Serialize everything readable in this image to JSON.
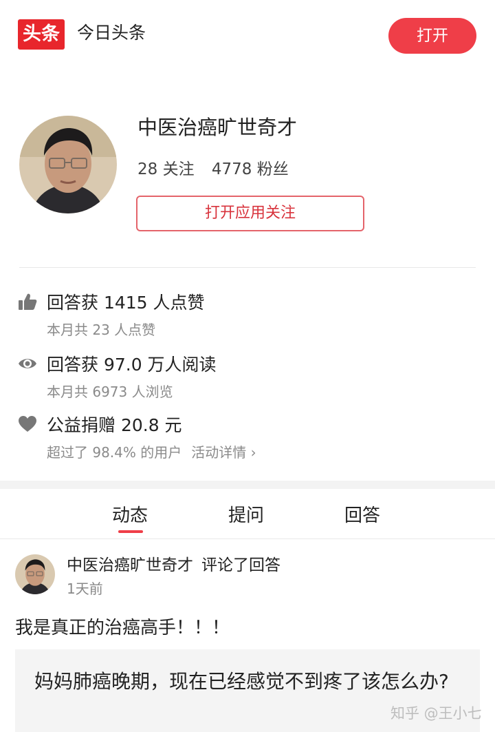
{
  "header": {
    "logo_text": "头条",
    "app_name": "今日头条",
    "open_label": "打开",
    "accent_color": "#ef3e48"
  },
  "profile": {
    "name": "中医治癌旷世奇才",
    "following": "28 关注",
    "followers": "4778 粉丝",
    "follow_button": "打开应用关注"
  },
  "stats": [
    {
      "icon": "thumbs-up-icon",
      "main": "回答获 1415 人点赞",
      "sub": "本月共 23 人点赞"
    },
    {
      "icon": "eye-icon",
      "main": "回答获 97.0 万人阅读",
      "sub": "本月共 6973 人浏览"
    },
    {
      "icon": "heart-icon",
      "main": "公益捐赠 20.8 元",
      "sub": "超过了 98.4% 的用户",
      "link": "活动详情 ›"
    }
  ],
  "tabs": [
    {
      "label": "动态",
      "active": true
    },
    {
      "label": "提问",
      "active": false
    },
    {
      "label": "回答",
      "active": false
    }
  ],
  "feed": {
    "author": "中医治癌旷世奇才",
    "action": "评论了回答",
    "time": "1天前",
    "comment": "我是真正的治癌高手！！！",
    "quote": "妈妈肺癌晚期，现在已经感觉不到疼了该怎么办?"
  },
  "watermark": "知乎 @王小七"
}
